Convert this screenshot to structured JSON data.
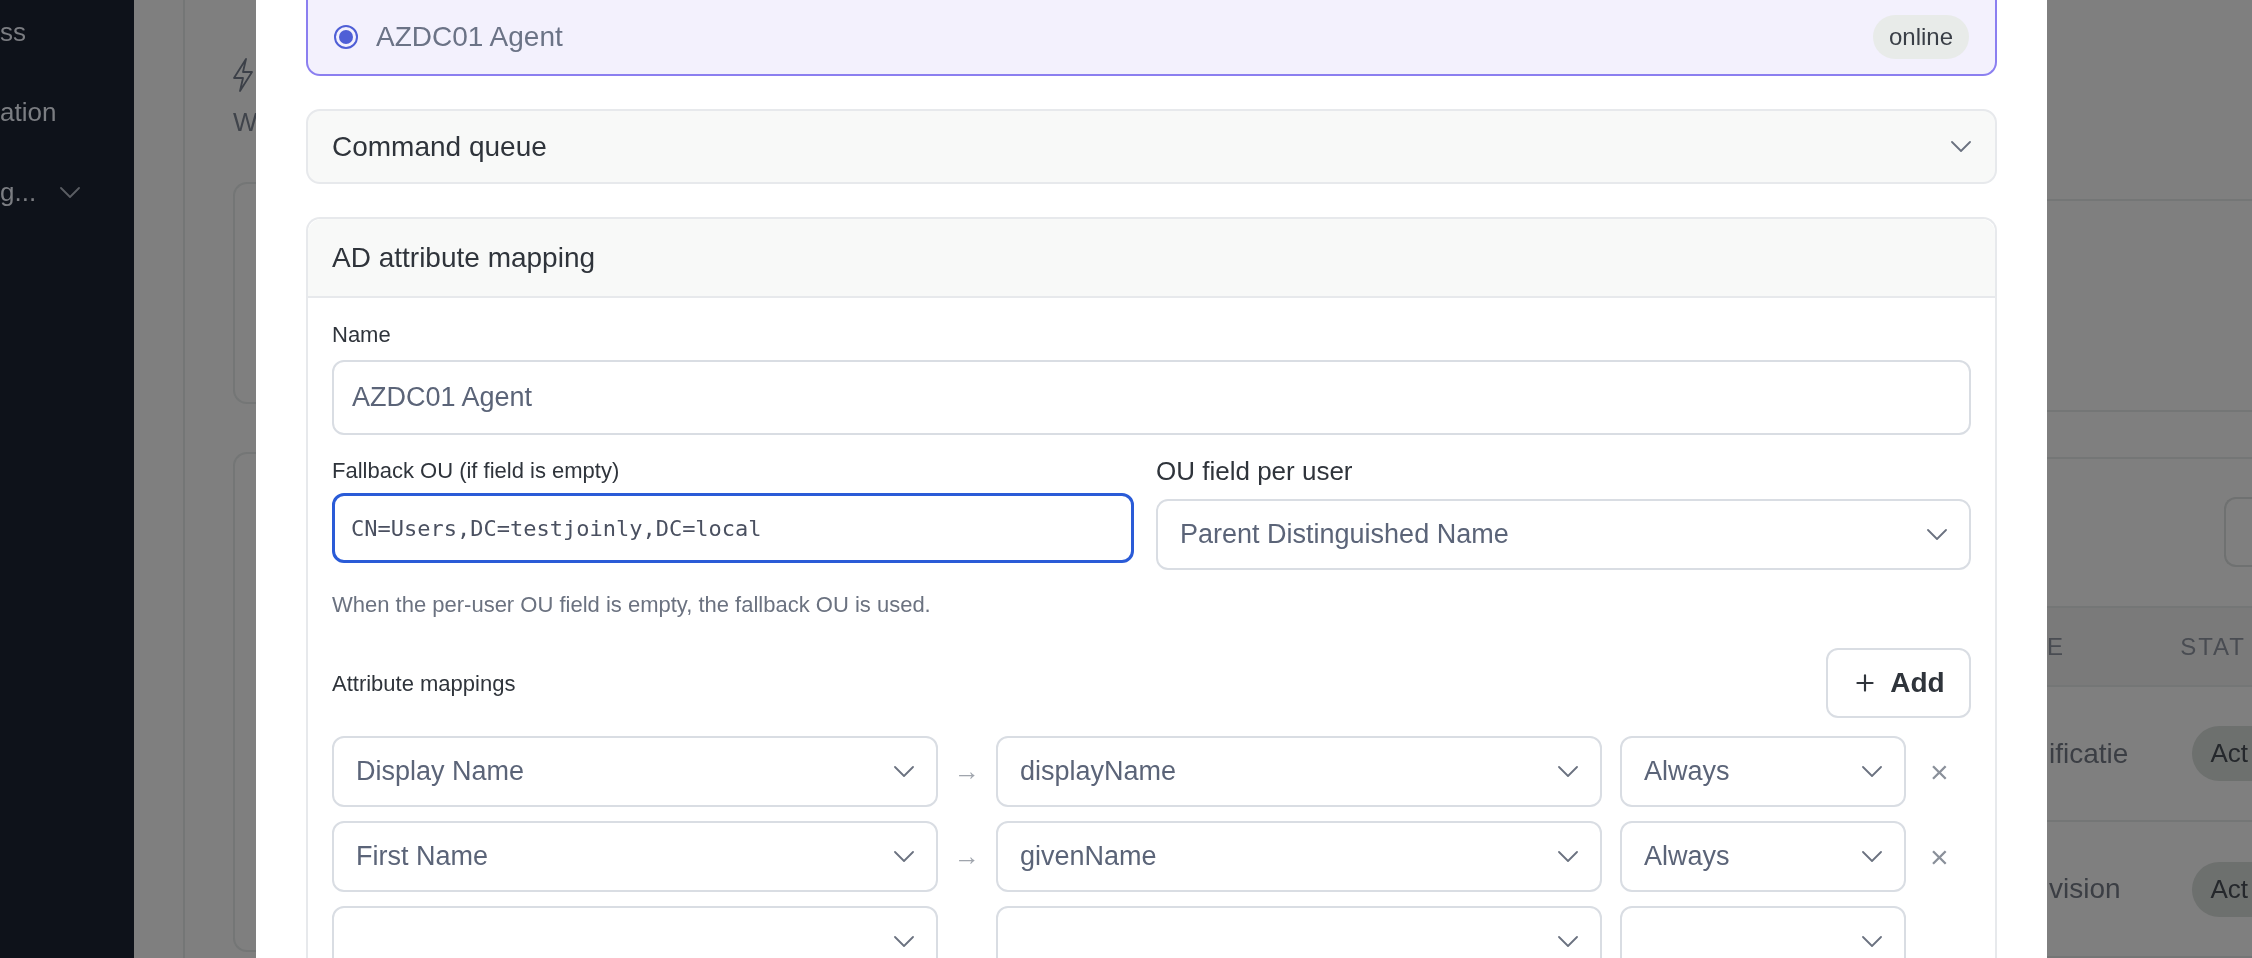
{
  "sidebar": {
    "items": [
      {
        "label": "ss",
        "expandable": false
      },
      {
        "label": "ation",
        "expandable": false
      },
      {
        "label": "g...",
        "expandable": true
      }
    ]
  },
  "background": {
    "heading": "W",
    "table": {
      "columns": [
        "E",
        "STAT"
      ],
      "rows": [
        {
          "cells": [
            "ificatie"
          ],
          "status": "Act"
        },
        {
          "cells": [
            "vision"
          ],
          "status": "Act"
        }
      ]
    }
  },
  "dialog": {
    "agents": [
      {
        "name": "AZDC01 Agent",
        "selected": true,
        "status": "online"
      }
    ],
    "sections": [
      {
        "title": "Command queue",
        "expanded": false
      },
      {
        "title": "AD attribute mapping",
        "expanded": true
      }
    ],
    "mapping": {
      "name_label": "Name",
      "name_value": "AZDC01 Agent",
      "fallback_label": "Fallback OU (if field is empty)",
      "fallback_value": "CN=Users,DC=testjoinly,DC=local",
      "ou_field_label": "OU field per user",
      "ou_field_value": "Parent Distinguished Name",
      "help": "When the per-user OU field is empty, the fallback OU is used.",
      "mappings_label": "Attribute mappings",
      "add_button": "Add",
      "rows": [
        {
          "source": "Display Name",
          "arrow": "→",
          "target": "displayName",
          "mode": "Always",
          "remove": "×"
        },
        {
          "source": "First Name",
          "arrow": "→",
          "target": "givenName",
          "mode": "Always",
          "remove": "×"
        },
        {}
      ]
    }
  }
}
